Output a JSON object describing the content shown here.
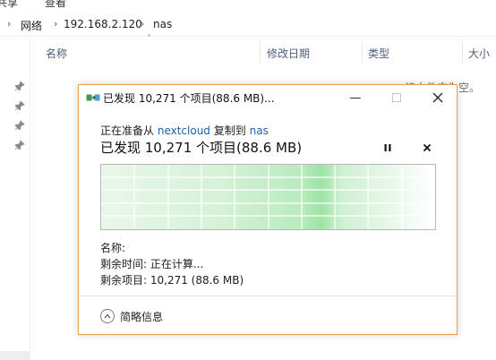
{
  "ribbon": {
    "share": "共享",
    "view": "查看"
  },
  "breadcrumb": {
    "items": [
      "网络",
      "192.168.2.120",
      "nas"
    ]
  },
  "columns": {
    "name": "名称",
    "modified": "修改日期",
    "type": "类型",
    "size": "大小"
  },
  "folder": {
    "empty_message": "该文件夹为空。"
  },
  "dialog": {
    "title": "已发现 10,271 个项目(88.6 MB)...",
    "copy_prefix": "正在准备从",
    "source": "nextcloud",
    "copy_middle": "复制到",
    "destination": "nas",
    "status": "已发现 10,271 个项目(88.6 MB)",
    "name_label": "名称:",
    "time_remaining": "剩余时间: 正在计算...",
    "items_remaining": "剩余项目: 10,271 (88.6 MB)",
    "details_toggle": "简略信息",
    "icons": {
      "minimize": "minimize-icon",
      "maximize": "maximize-icon",
      "close": "close-icon",
      "pause": "pause-icon",
      "cancel": "cancel-icon",
      "collapse": "chevron-up-icon",
      "title": "copy-icon"
    }
  },
  "colors": {
    "dialog_border": "#e8a440",
    "link": "#1a5fb4",
    "progress": "#38c94a"
  }
}
